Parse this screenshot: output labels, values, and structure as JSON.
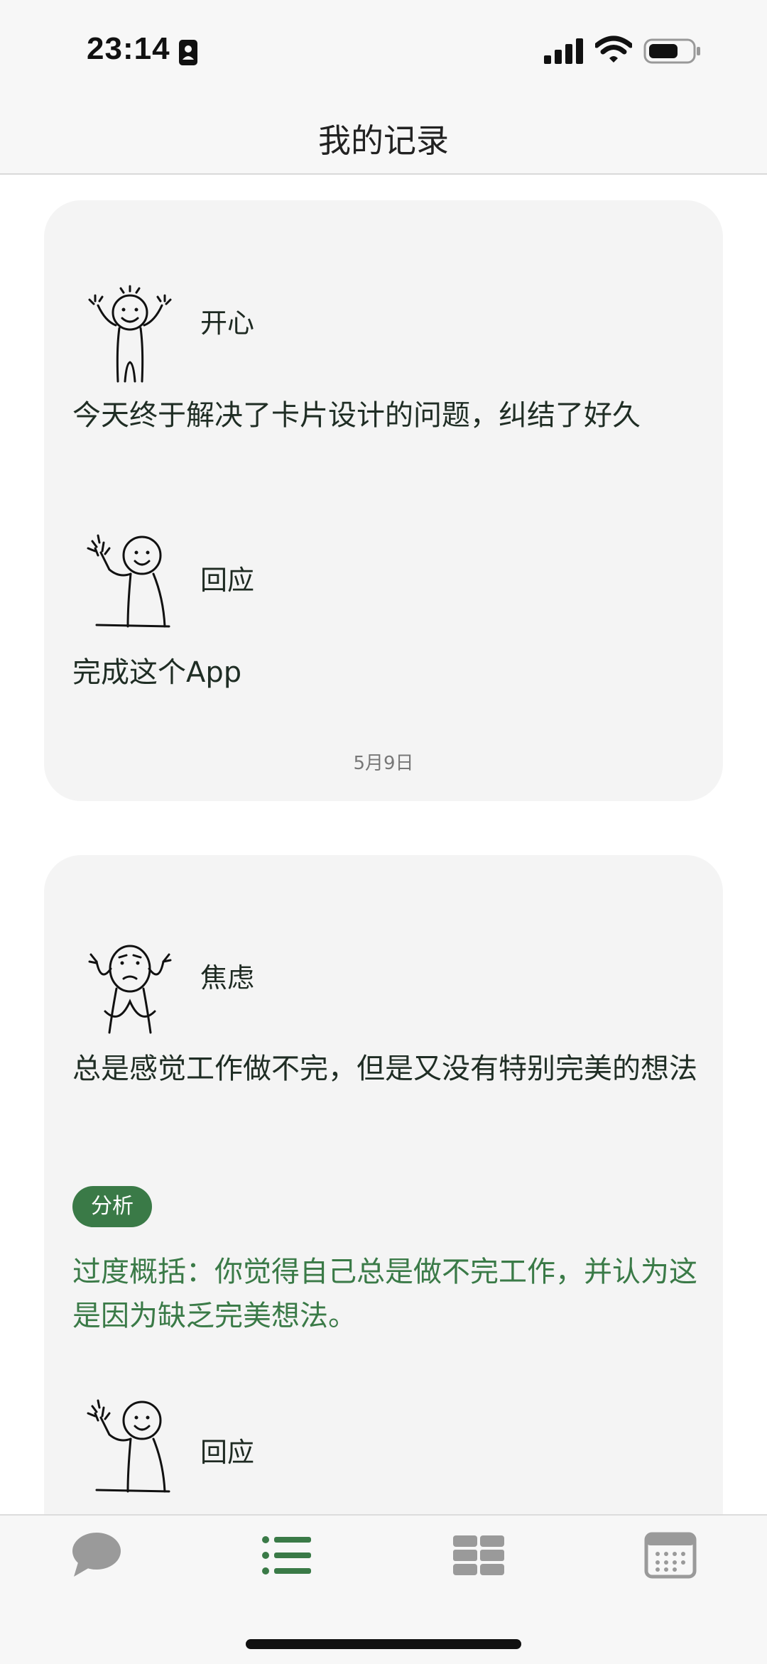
{
  "status_bar": {
    "time": "23:14"
  },
  "nav": {
    "title": "我的记录"
  },
  "cards": [
    {
      "mood_label": "开心",
      "text": "今天终于解决了卡片设计的问题，纠结了好久",
      "response_label": "回应",
      "response_text": "完成这个App",
      "date": "5月9日"
    },
    {
      "mood_label": "焦虑",
      "text": "总是感觉工作做不完，但是又没有特别完美的想法",
      "tag": "分析",
      "analysis": " 过度概括：你觉得自己总是做不完工作，并认为这是因为缺乏完美想法。",
      "response_label": "回应"
    }
  ],
  "tab_bar": {
    "active": "list",
    "tabs": [
      "chat-icon",
      "list-icon",
      "grid-icon",
      "calendar-icon"
    ]
  },
  "colors": {
    "accent": "#3a7a47",
    "card_bg": "#f4f4f4",
    "inactive_icon": "#9a9a9a"
  }
}
